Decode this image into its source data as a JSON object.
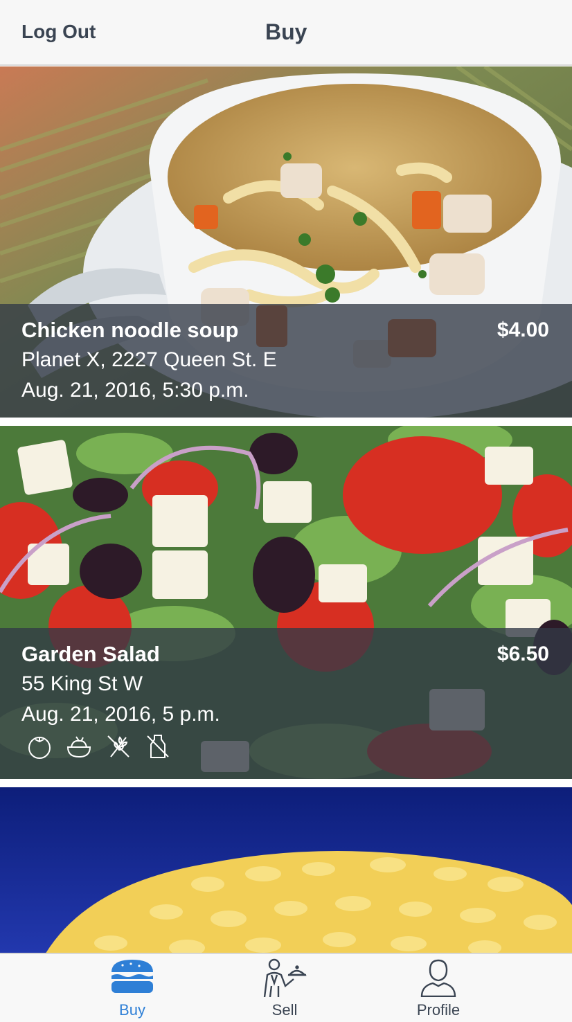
{
  "navbar": {
    "logout_label": "Log Out",
    "title": "Buy"
  },
  "listings": [
    {
      "name": "Chicken noodle soup",
      "price": "$4.00",
      "location": "Planet X, 2227 Queen St. E",
      "time": "Aug. 21, 2016, 5:30 p.m."
    },
    {
      "name": "Garden Salad",
      "price": "$6.50",
      "location": "55 King St W",
      "time": "Aug. 21, 2016, 5 p.m.",
      "diet_icons": [
        "tomato-icon",
        "bowl-icon",
        "gluten-free-icon",
        "dairy-free-icon"
      ]
    },
    {
      "image": "mac-and-cheese-photo"
    }
  ],
  "tabbar": {
    "tabs": [
      {
        "label": "Buy",
        "icon": "burger-icon",
        "active": true
      },
      {
        "label": "Sell",
        "icon": "waiter-icon",
        "active": false
      },
      {
        "label": "Profile",
        "icon": "person-icon",
        "active": false
      }
    ]
  },
  "colors": {
    "active_tab": "#2e7fd6",
    "inactive_tab": "#3a4452",
    "overlay": "#323a46",
    "nav_text": "#3a4452"
  }
}
